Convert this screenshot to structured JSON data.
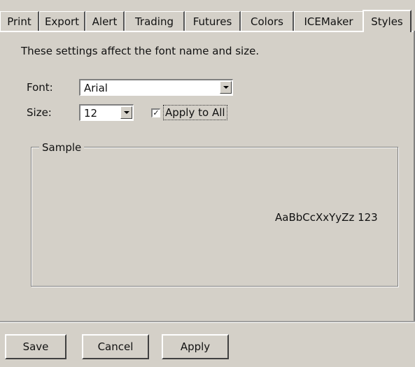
{
  "tabs": [
    {
      "label": "Print"
    },
    {
      "label": "Export"
    },
    {
      "label": "Alert"
    },
    {
      "label": "Trading"
    },
    {
      "label": "Futures"
    },
    {
      "label": "Colors"
    },
    {
      "label": "ICEMaker"
    },
    {
      "label": "Styles",
      "active": true
    }
  ],
  "styles": {
    "description": "These settings affect the font name and size.",
    "font_label": "Font:",
    "font_value": "Arial",
    "size_label": "Size:",
    "size_value": "12",
    "apply_all_label": "Apply to All",
    "apply_all_checked": true,
    "check_mark": "✓",
    "sample_title": "Sample",
    "sample_text": "AaBbCcXxYyZz 123"
  },
  "buttons": {
    "save": "Save",
    "cancel": "Cancel",
    "apply": "Apply"
  }
}
